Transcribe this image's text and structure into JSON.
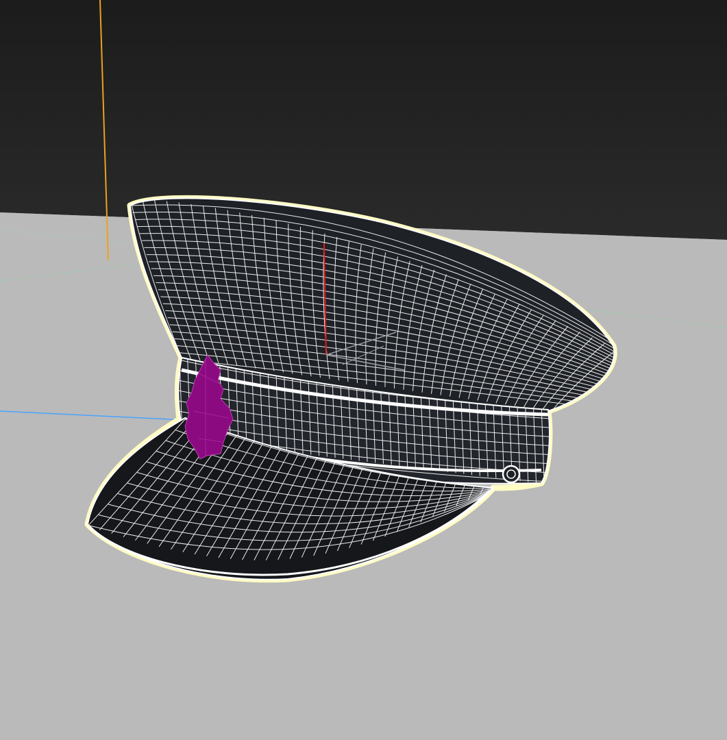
{
  "viewport": {
    "label": "",
    "background_top": "#232323",
    "ground_color": "#bababa",
    "selection_highlight": "#fffbc4",
    "wire_color": "#ffffff",
    "surface_color": "#1e2126"
  },
  "scene": {
    "object": "peaked cap",
    "badge_color": "#8b0a80",
    "axis_colors": {
      "x": "#e01b1b",
      "y": "#4aa3ff",
      "z": "#f0a020"
    }
  },
  "icons": [
    "gizmo-icon",
    "badge-emblem-icon",
    "button-rivet-icon"
  ]
}
